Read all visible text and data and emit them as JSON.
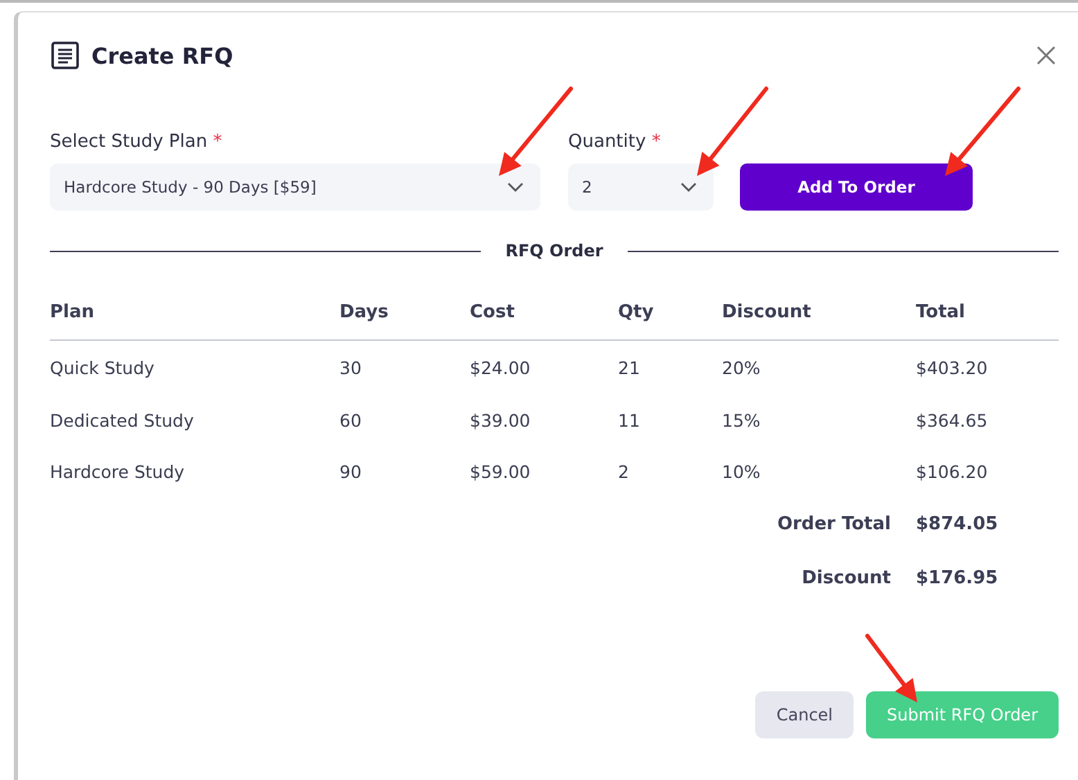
{
  "dialog": {
    "title": "Create RFQ"
  },
  "form": {
    "plan": {
      "label": "Select Study Plan",
      "required_mark": "*",
      "value": "Hardcore Study - 90 Days [$59]"
    },
    "quantity": {
      "label": "Quantity",
      "required_mark": "*",
      "value": "2"
    },
    "add_button": "Add To Order"
  },
  "section_title": "RFQ Order",
  "table": {
    "columns": [
      "Plan",
      "Days",
      "Cost",
      "Qty",
      "Discount",
      "Total"
    ],
    "rows": [
      {
        "plan": "Quick Study",
        "days": "30",
        "cost": "$24.00",
        "qty": "21",
        "discount": "20%",
        "total": "$403.20"
      },
      {
        "plan": "Dedicated Study",
        "days": "60",
        "cost": "$39.00",
        "qty": "11",
        "discount": "15%",
        "total": "$364.65"
      },
      {
        "plan": "Hardcore Study",
        "days": "90",
        "cost": "$59.00",
        "qty": "2",
        "discount": "10%",
        "total": "$106.20"
      }
    ]
  },
  "summary": [
    {
      "label": "Order Total",
      "value": "$874.05"
    },
    {
      "label": "Discount",
      "value": "$176.95"
    }
  ],
  "buttons": [
    {
      "label": "Cancel",
      "kind": "secondary"
    },
    {
      "label": "Submit RFQ Order",
      "kind": "primary"
    }
  ]
}
